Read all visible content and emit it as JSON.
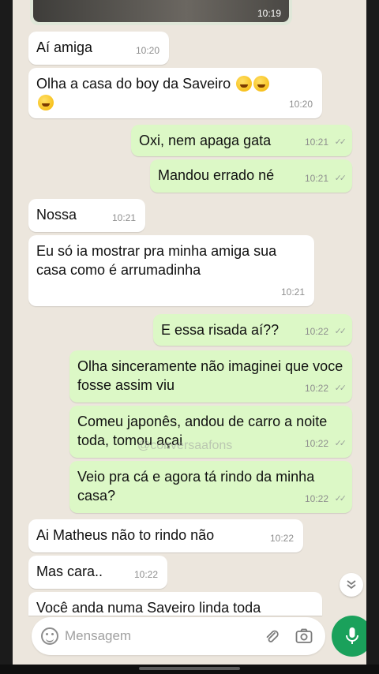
{
  "media": {
    "time": "10:19"
  },
  "messages": [
    {
      "dir": "in",
      "text": "Aí amiga",
      "time": "10:20"
    },
    {
      "dir": "in",
      "text": "Olha a casa do boy da Saveiro",
      "time": "10:20",
      "emoji_icon": "rofl-emoji"
    },
    {
      "dir": "out",
      "text": "Oxi, nem apaga gata",
      "time": "10:21"
    },
    {
      "dir": "out",
      "text": "Mandou errado né",
      "time": "10:21"
    },
    {
      "dir": "in",
      "text": "Nossa",
      "time": "10:21"
    },
    {
      "dir": "in",
      "text": "Eu só ia mostrar pra minha amiga sua casa como é arrumadinha",
      "time": "10:21"
    },
    {
      "dir": "out",
      "text": "E essa risada aí??",
      "time": "10:22"
    },
    {
      "dir": "out",
      "text": "Olha sinceramente não imaginei que voce fosse assim viu",
      "time": "10:22"
    },
    {
      "dir": "out",
      "text": "Comeu japonês, andou de carro a noite toda, tomou açai",
      "time": "10:22"
    },
    {
      "dir": "out",
      "text": "Veio pra cá e agora tá rindo da minha casa?",
      "time": "10:22"
    },
    {
      "dir": "in",
      "text": "Ai Matheus não to rindo não",
      "time": "10:22"
    },
    {
      "dir": "in",
      "text": "Mas cara..",
      "time": "10:22"
    },
    {
      "dir": "in",
      "text": "Você anda numa Saveiro linda toda",
      "time": ""
    }
  ],
  "watermark": "@conversaafons",
  "composer": {
    "placeholder": "Mensagem"
  },
  "icons": {
    "emoji": "emoji-icon",
    "attach": "paperclip-icon",
    "camera": "camera-icon",
    "mic": "microphone-icon",
    "scroll": "double-chevron-down-icon"
  },
  "colors": {
    "chat_bg": "#ece6dd",
    "incoming": "#ffffff",
    "outgoing": "#dcf8c6",
    "accent": "#1aa15b"
  }
}
